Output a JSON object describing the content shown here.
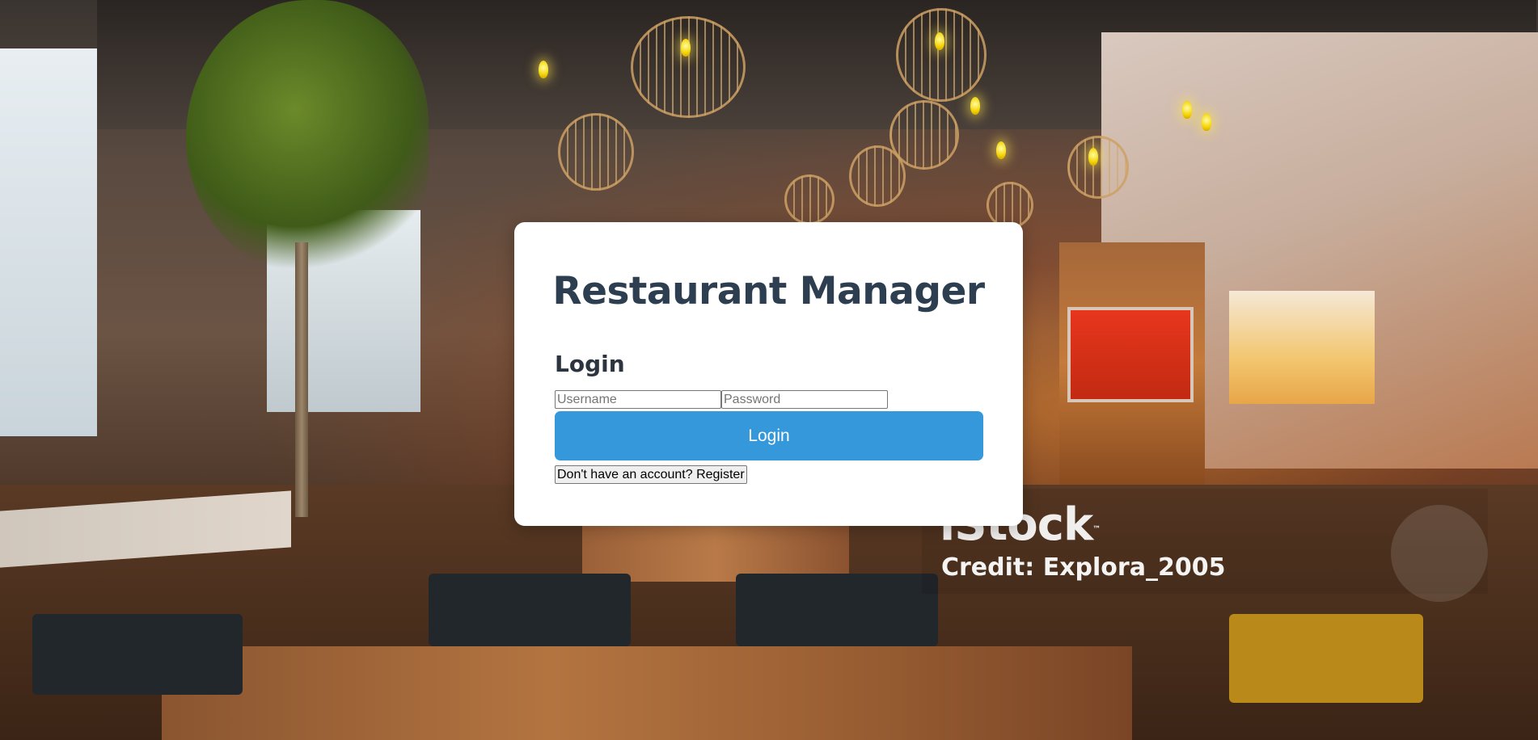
{
  "app": {
    "title": "Restaurant Manager"
  },
  "login_form": {
    "heading": "Login",
    "username_placeholder": "Username",
    "password_placeholder": "Password",
    "submit_label": "Login",
    "register_label": "Don't have an account? Register"
  },
  "watermark": {
    "brand": "iStock",
    "trademark": "™",
    "credit": "Credit: Explora_2005"
  },
  "colors": {
    "primary_button": "#3498db",
    "title_text": "#2c3e50",
    "card_background": "#ffffff"
  }
}
